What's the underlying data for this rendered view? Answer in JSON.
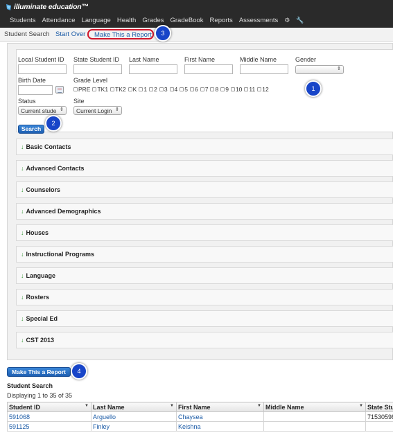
{
  "app": {
    "logo_text": "illuminate education™",
    "nav": [
      "Students",
      "Attendance",
      "Language",
      "Health",
      "Grades",
      "GradeBook",
      "Reports",
      "Assessments"
    ]
  },
  "subnav": {
    "student_search": "Student Search",
    "start_over": "Start Over",
    "make_report": "Make This a Report"
  },
  "badges": [
    "1",
    "2",
    "3",
    "4"
  ],
  "form": {
    "local_id_label": "Local Student ID",
    "state_id_label": "State Student ID",
    "last_name_label": "Last Name",
    "first_name_label": "First Name",
    "middle_name_label": "Middle Name",
    "gender_label": "Gender",
    "birth_date_label": "Birth Date",
    "grade_level_label": "Grade Level",
    "grades": [
      "PRE",
      "TK1",
      "TK2",
      "K",
      "1",
      "2",
      "3",
      "4",
      "5",
      "6",
      "7",
      "8",
      "9",
      "10",
      "11",
      "12"
    ],
    "status_label": "Status",
    "status_value": "Current stude",
    "site_label": "Site",
    "site_value": "Current Login",
    "search_button": "Search"
  },
  "sections": [
    "Basic Contacts",
    "Advanced Contacts",
    "Counselors",
    "Advanced Demographics",
    "Houses",
    "Instructional Programs",
    "Language",
    "Rosters",
    "Special Ed",
    "CST 2013"
  ],
  "results": {
    "report_button": "Make This a Report",
    "title": "Student Search",
    "count": "Displaying 1 to 35 of 35",
    "columns": [
      "Student ID",
      "Last Name",
      "First Name",
      "Middle Name",
      "State Stu"
    ],
    "rows": [
      [
        "591068",
        "Arguello",
        "Chaysea",
        "",
        "71530598"
      ],
      [
        "591125",
        "Finley",
        "Keishna",
        "",
        ""
      ]
    ]
  },
  "colors": {
    "topbar": "#2a2a2a",
    "link": "#1a5aa6",
    "badge": "#1845c8",
    "highlight": "#d0152a",
    "button": "#1e5fb2"
  },
  "icons": [
    "logo-icon",
    "gear-icon",
    "wrench-icon",
    "calendar-icon",
    "expand-arrow-icon",
    "sort-icon"
  ]
}
